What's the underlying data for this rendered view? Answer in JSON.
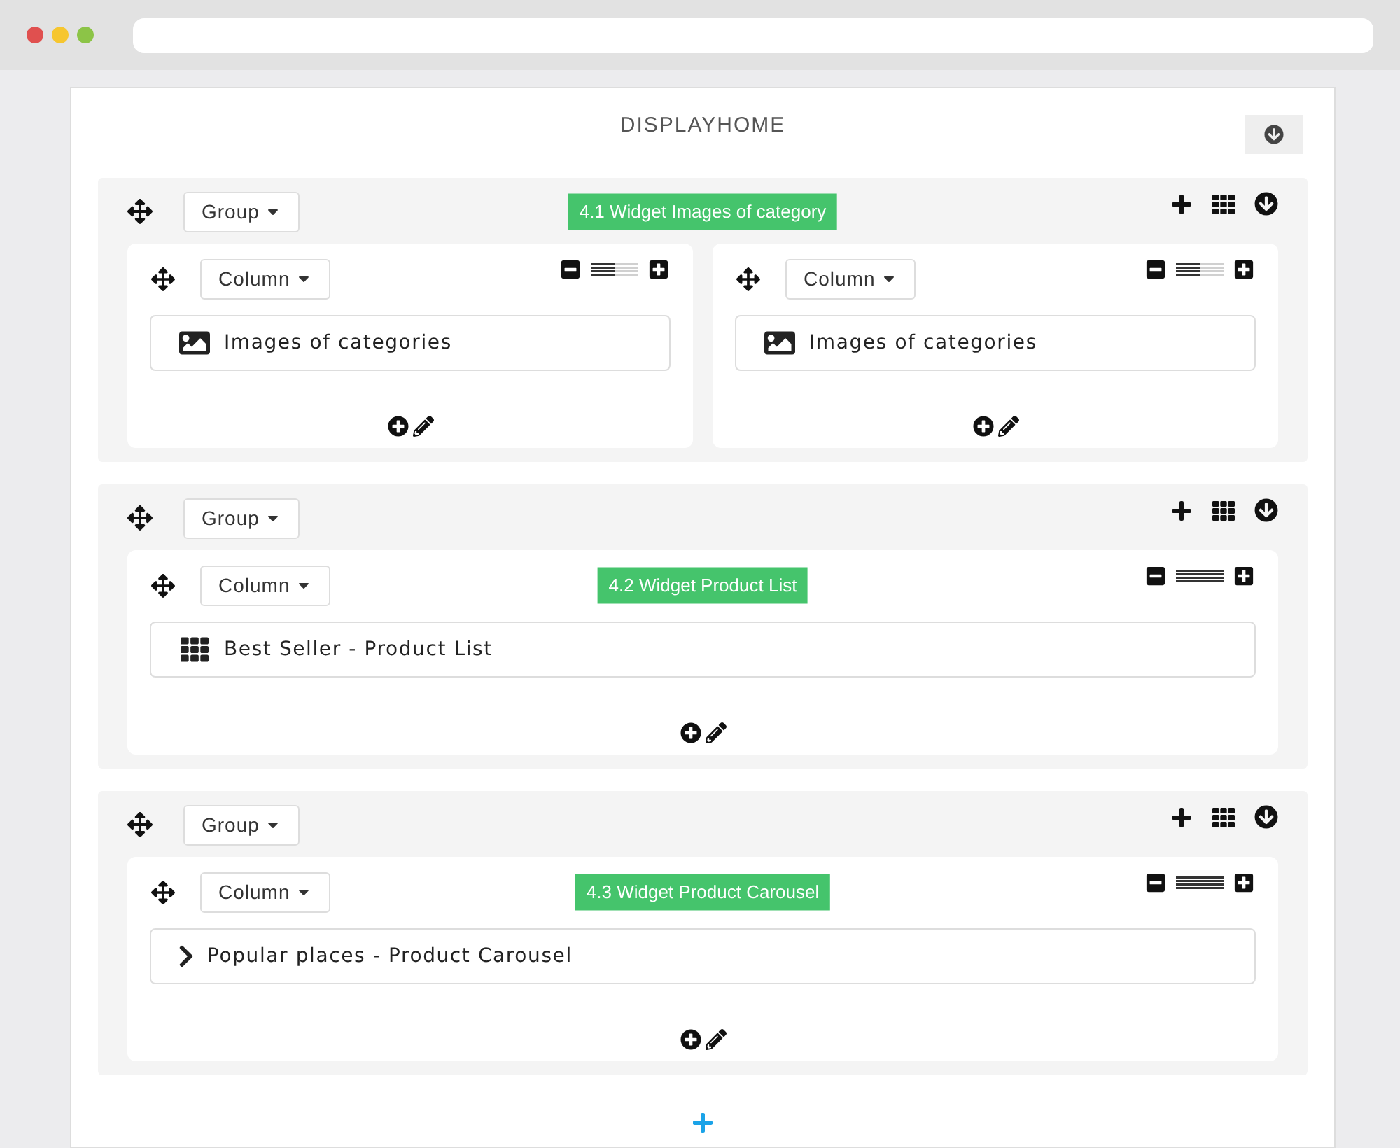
{
  "page_title": "DISPLAYHOME",
  "groups": [
    {
      "button": "Group",
      "annotation": "4.1 Widget Images  of category",
      "columns": [
        {
          "button": "Column",
          "level": 0.5,
          "widgets": [
            {
              "kind": "image",
              "label": "Images of categories"
            }
          ]
        },
        {
          "button": "Column",
          "level": 0.5,
          "widgets": [
            {
              "kind": "image",
              "label": "Images of categories"
            }
          ]
        }
      ]
    },
    {
      "button": "Group",
      "columns": [
        {
          "button": "Column",
          "annotation": "4.2  Widget Product List",
          "level": 1,
          "widgets": [
            {
              "kind": "grid",
              "label": "Best Seller - Product List"
            }
          ]
        }
      ]
    },
    {
      "button": "Group",
      "columns": [
        {
          "button": "Column",
          "annotation": "4.3  Widget Product Carousel",
          "level": 1,
          "widgets": [
            {
              "kind": "chevron",
              "label": "Popular places - Product Carousel"
            }
          ]
        }
      ]
    }
  ]
}
